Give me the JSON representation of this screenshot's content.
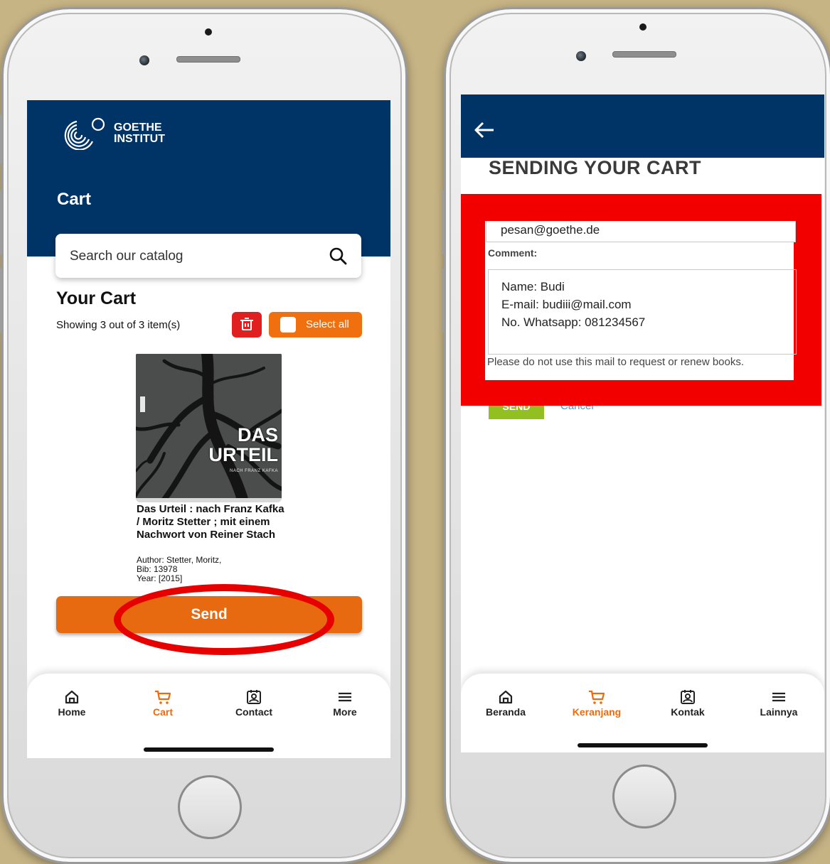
{
  "left_screen": {
    "brand": "GOETHE\nINSTITUT",
    "page_title": "Cart",
    "search": {
      "placeholder": "Search our catalog"
    },
    "cart_heading": "Your Cart",
    "showing_text": "Showing 3 out of 3 item(s)",
    "select_all_label": "Select all",
    "book": {
      "cover_title": "DAS\nURTEIL",
      "cover_subtitle": "NACH FRANZ KAFKA",
      "title": "Das Urteil : nach Franz Kafka / Moritz Stetter ; mit einem Nachwort von Reiner Stach",
      "author": "Author: Stetter, Moritz,",
      "bib": "Bib: 13978",
      "year": "Year: [2015]"
    },
    "send_label": "Send",
    "tabs": [
      {
        "label": "Home",
        "icon": "home-icon"
      },
      {
        "label": "Cart",
        "icon": "cart-icon",
        "active": true
      },
      {
        "label": "Contact",
        "icon": "contact-icon"
      },
      {
        "label": "More",
        "icon": "menu-icon"
      }
    ]
  },
  "right_screen": {
    "page_title": "SENDING YOUR CART",
    "email_value": "pesan@goethe.de",
    "comment_label": "Comment:",
    "comment_lines": [
      "Name: Budi",
      "E-mail: budiii@mail.com",
      "No. Whatsapp: 081234567"
    ],
    "hint": "Please do not use this mail to request or renew books.",
    "send_label": "SEND",
    "cancel_label": "Cancel",
    "tabs": [
      {
        "label": "Beranda",
        "icon": "home-icon"
      },
      {
        "label": "Keranjang",
        "icon": "cart-icon",
        "active": true
      },
      {
        "label": "Kontak",
        "icon": "contact-icon"
      },
      {
        "label": "Lainnya",
        "icon": "menu-icon"
      }
    ]
  },
  "colors": {
    "header_blue": "#003366",
    "accent_orange": "#e86a10",
    "highlight_red": "#e60000",
    "send_green": "#92c020",
    "background": "#c7b485"
  }
}
